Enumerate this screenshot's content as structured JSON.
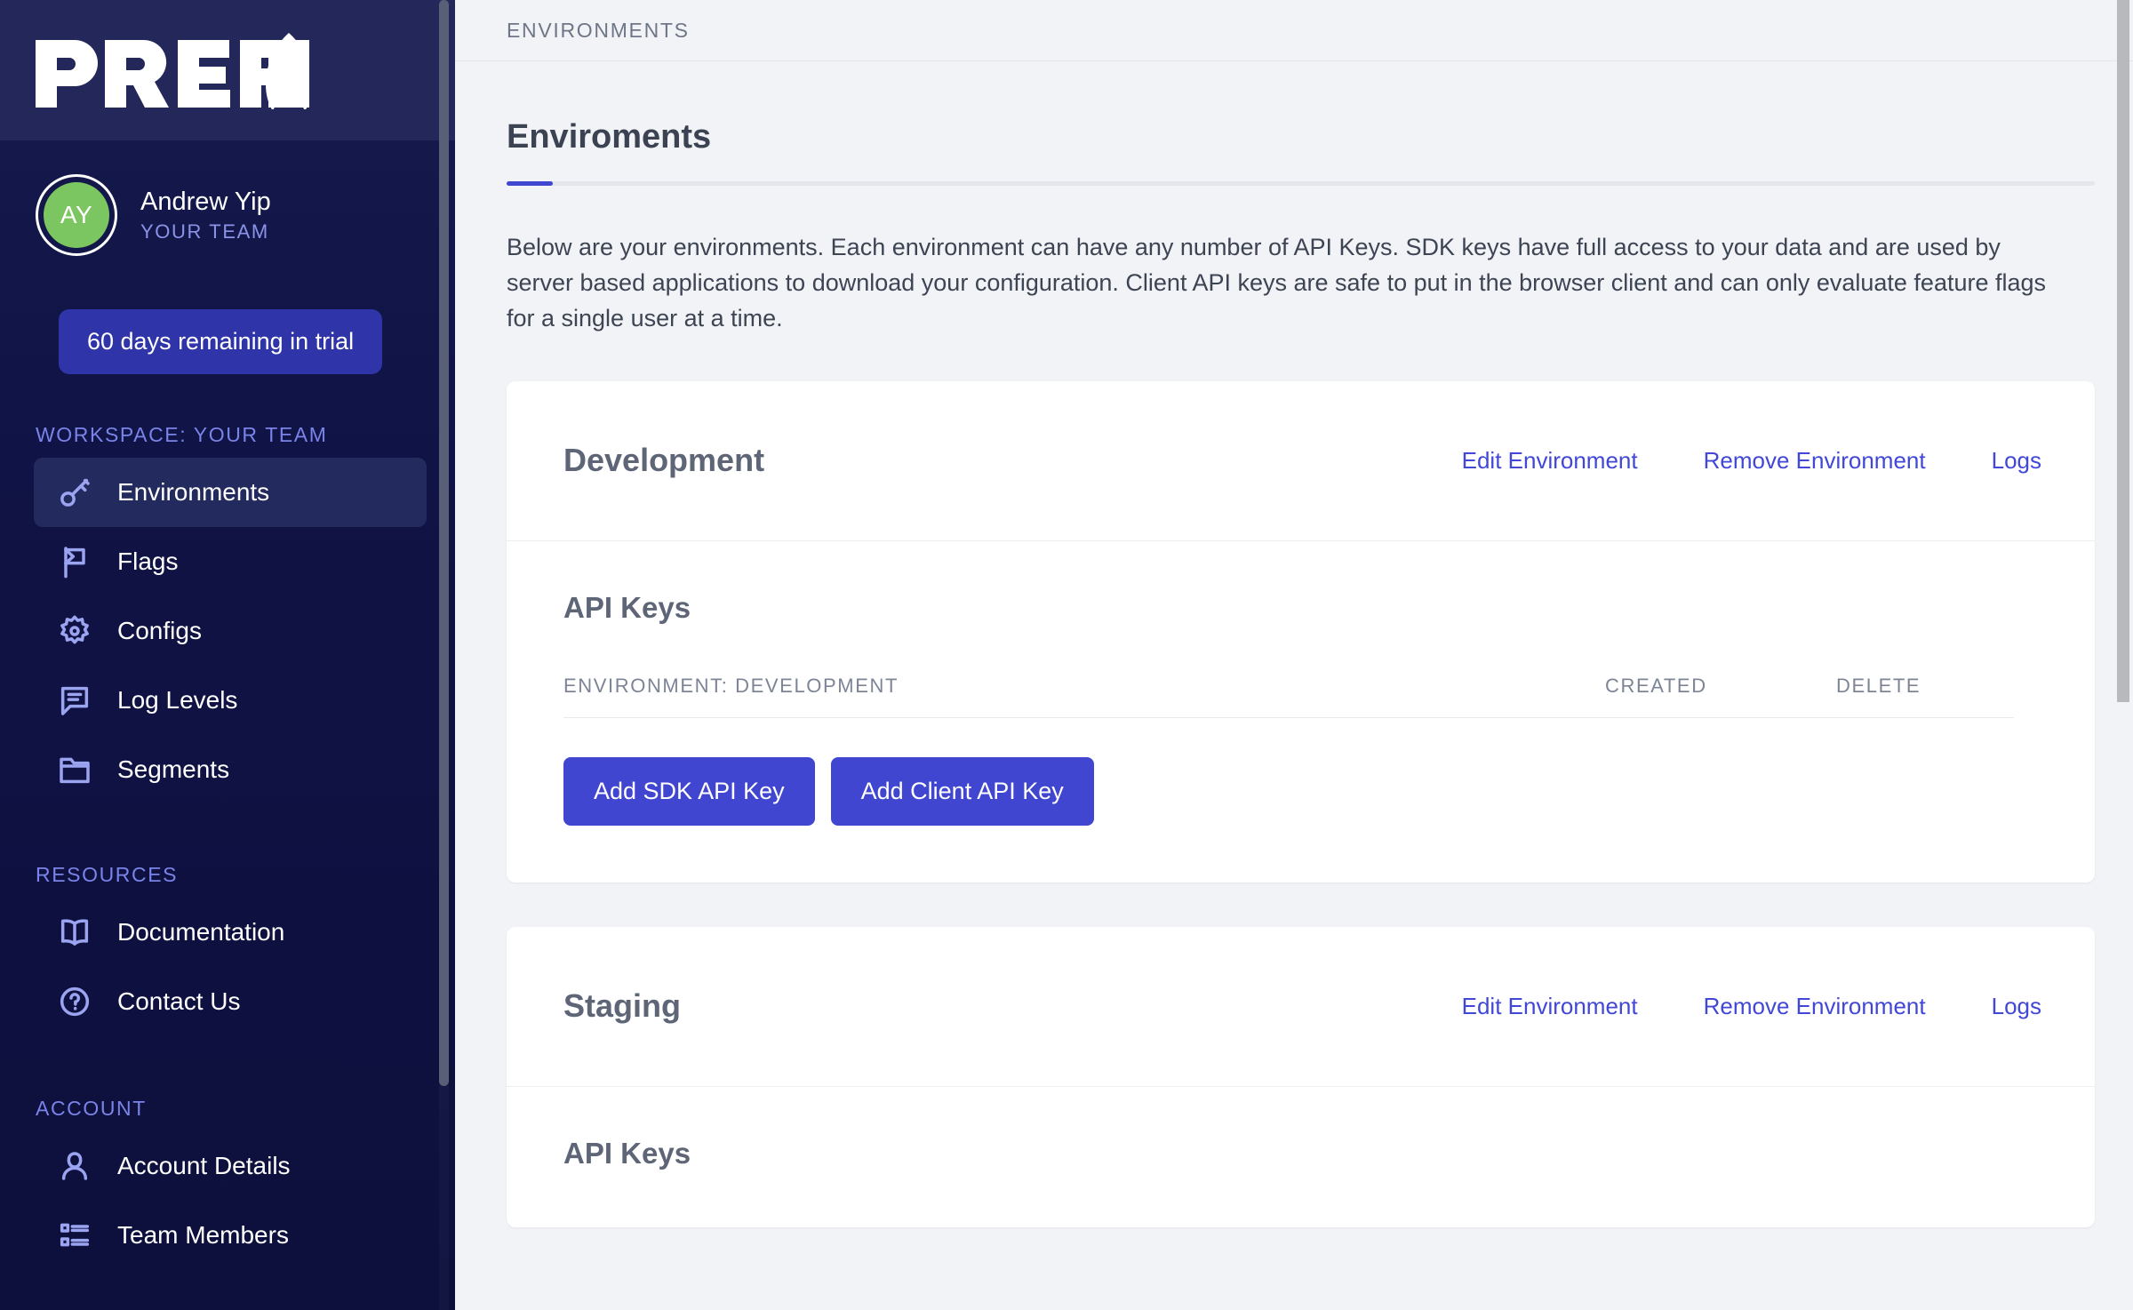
{
  "brand": {
    "logo_text": "PREFAB",
    "logo_icon": "rocket-delta-icon"
  },
  "user": {
    "initials": "AY",
    "name": "Andrew Yip",
    "team": "YOUR TEAM",
    "avatar_color": "#7cc661"
  },
  "trial": {
    "label": "60 days remaining in trial"
  },
  "sidebar": {
    "sections": [
      {
        "label": "WORKSPACE: YOUR TEAM",
        "items": [
          {
            "label": "Environments",
            "icon": "key-icon",
            "active": true
          },
          {
            "label": "Flags",
            "icon": "flag-icon",
            "active": false
          },
          {
            "label": "Configs",
            "icon": "gear-icon",
            "active": false
          },
          {
            "label": "Log Levels",
            "icon": "chat-lines-icon",
            "active": false
          },
          {
            "label": "Segments",
            "icon": "folder-icon",
            "active": false
          }
        ]
      },
      {
        "label": "RESOURCES",
        "items": [
          {
            "label": "Documentation",
            "icon": "book-icon",
            "active": false
          },
          {
            "label": "Contact Us",
            "icon": "question-circle-icon",
            "active": false
          }
        ]
      },
      {
        "label": "ACCOUNT",
        "items": [
          {
            "label": "Account Details",
            "icon": "person-icon",
            "active": false
          },
          {
            "label": "Team Members",
            "icon": "list-icon",
            "active": false
          }
        ]
      }
    ]
  },
  "topbar": {
    "breadcrumb": "ENVIRONMENTS"
  },
  "page": {
    "title": "Enviroments",
    "accent_color": "#4046cf",
    "intro": "Below are your environments. Each environment can have any number of API Keys. SDK keys have full access to your data and are used by server based applications to download your configuration. Client API keys are safe to put in the browser client and can only evaluate feature flags for a single user at a time."
  },
  "environments": [
    {
      "name": "Development",
      "actions": [
        {
          "label": "Edit Environment"
        },
        {
          "label": "Remove Environment"
        },
        {
          "label": "Logs"
        }
      ],
      "api_keys": {
        "heading": "API Keys",
        "columns": [
          "ENVIRONMENT: DEVELOPMENT",
          "CREATED",
          "DELETE"
        ],
        "rows": [],
        "buttons": [
          {
            "label": "Add SDK API Key"
          },
          {
            "label": "Add Client API Key"
          }
        ]
      }
    },
    {
      "name": "Staging",
      "actions": [
        {
          "label": "Edit Environment"
        },
        {
          "label": "Remove Environment"
        },
        {
          "label": "Logs"
        }
      ],
      "api_keys": {
        "heading": "API Keys",
        "columns": [],
        "rows": [],
        "buttons": []
      }
    }
  ]
}
